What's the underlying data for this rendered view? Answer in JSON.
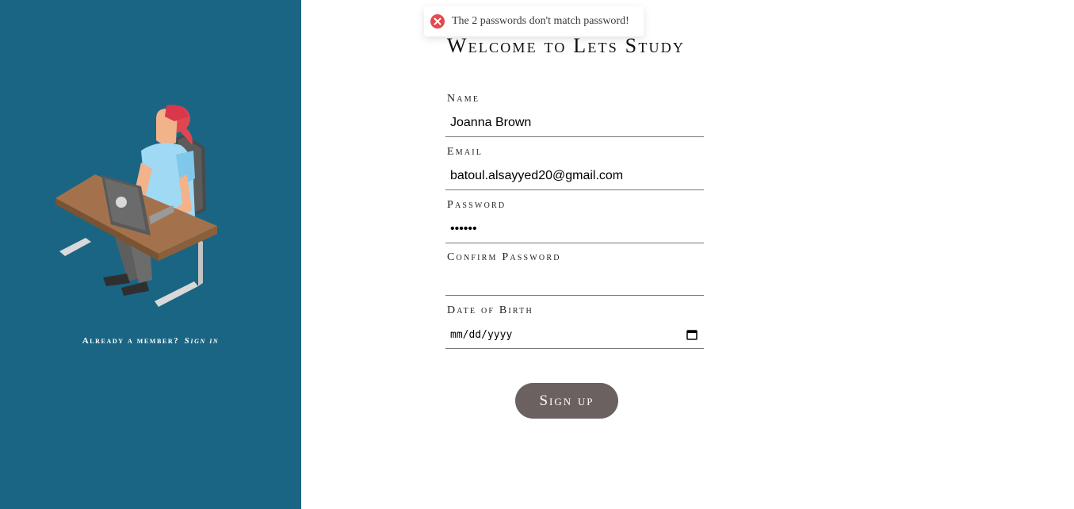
{
  "sidebar": {
    "member_prompt": "Already a member?",
    "signin_link": "Sign in"
  },
  "toast": {
    "icon": "error-circle-icon",
    "message": "The 2 passwords don't match password!"
  },
  "form": {
    "title": "Welcome to Lets Study",
    "fields": [
      {
        "label": "Name",
        "value": "Joanna Brown"
      },
      {
        "label": "Email",
        "value": "batoul.alsayyed20@gmail.com"
      },
      {
        "label": "Password",
        "value": "••••••"
      },
      {
        "label": "Confirm Password",
        "value": ""
      },
      {
        "label": "Date of Birth",
        "value": "mm/dd/yyyy"
      }
    ],
    "submit_label": "Sign up"
  },
  "colors": {
    "sidebar_bg": "#1b6584",
    "button_bg": "#6b6160",
    "error": "#e5484d"
  }
}
